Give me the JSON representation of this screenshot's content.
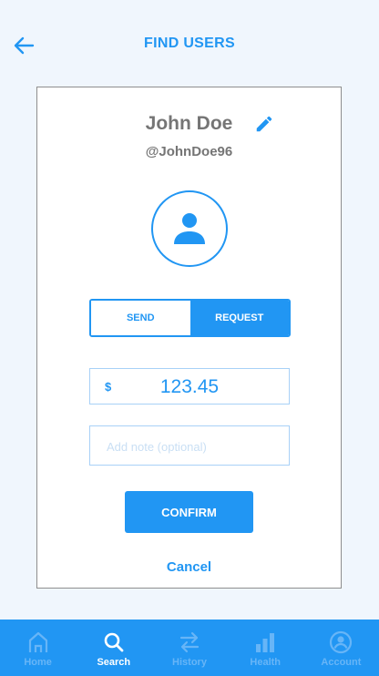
{
  "header": {
    "title": "FIND USERS",
    "back_icon": "arrow-left-icon"
  },
  "profile": {
    "name": "John Doe",
    "handle": "@JohnDoe96",
    "edit_icon": "pencil-icon",
    "avatar_icon": "person-icon"
  },
  "mode_toggle": {
    "options": [
      "SEND",
      "REQUEST"
    ],
    "selected": "REQUEST"
  },
  "amount": {
    "currency": "$",
    "value": "123.45"
  },
  "note": {
    "placeholder": "Add note (optional)",
    "value": ""
  },
  "actions": {
    "confirm_label": "CONFIRM",
    "cancel_label": "Cancel"
  },
  "tabbar": {
    "items": [
      {
        "label": "Home",
        "icon": "home-icon",
        "active": false
      },
      {
        "label": "Search",
        "icon": "search-icon",
        "active": true
      },
      {
        "label": "History",
        "icon": "transfer-arrows-icon",
        "active": false
      },
      {
        "label": "Health",
        "icon": "bar-chart-icon",
        "active": false
      },
      {
        "label": "Account",
        "icon": "account-circle-icon",
        "active": false
      }
    ]
  },
  "colors": {
    "accent": "#2196f3",
    "background": "#f0f6fd",
    "muted_text": "#757575",
    "inactive_tab": "#67b5f7"
  }
}
